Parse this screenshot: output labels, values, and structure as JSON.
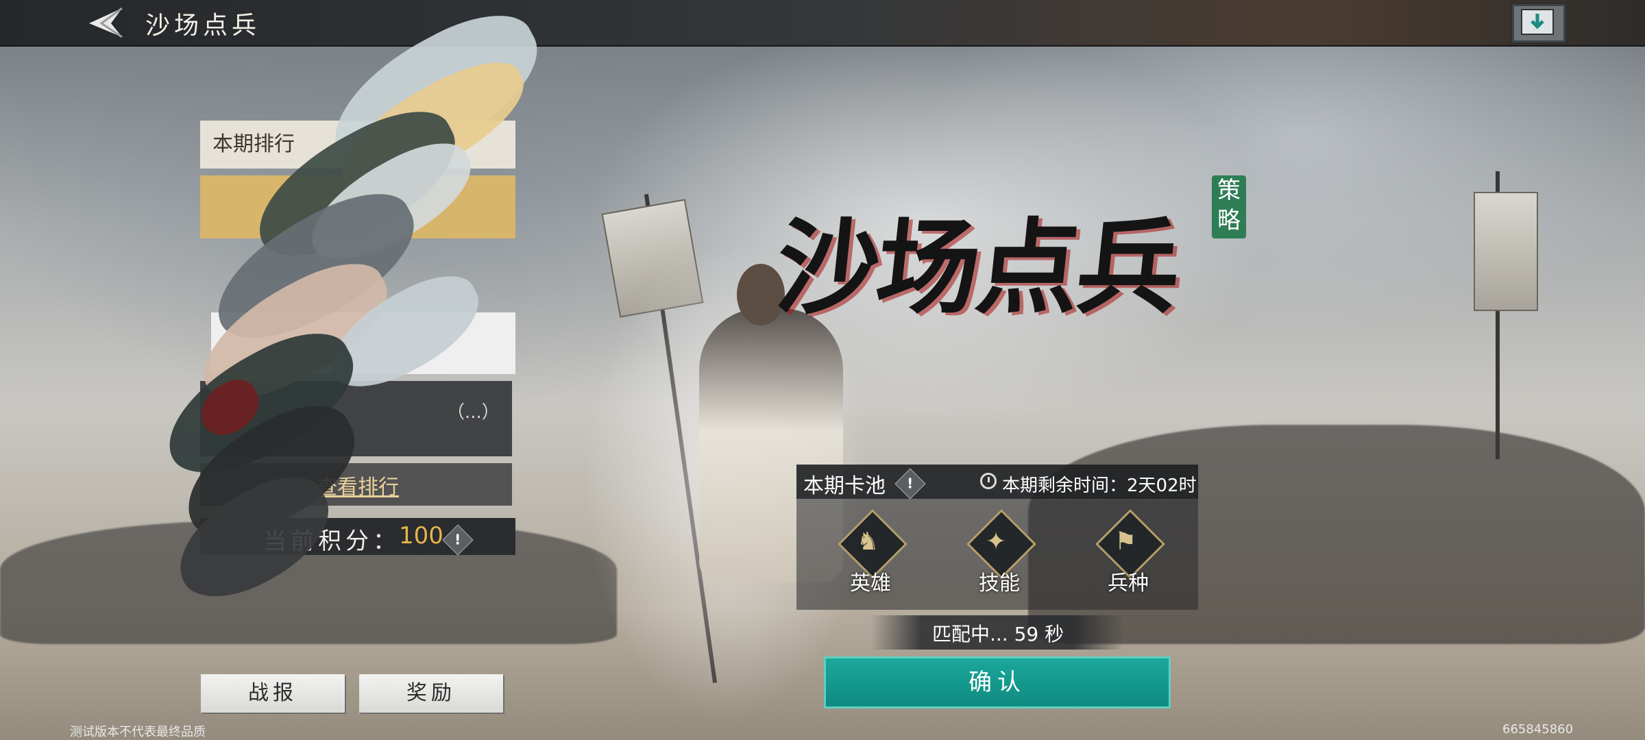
{
  "header": {
    "title": "沙场点兵"
  },
  "left_panel": {
    "header_label": "本期排行",
    "dark_row_text": "（...）",
    "view_ranking_label": "查看排行",
    "score_label": "当前积分：",
    "score_value": "100"
  },
  "logo": {
    "title": "沙场点兵",
    "seal": "策略"
  },
  "pool": {
    "title": "本期卡池",
    "remaining_time": "本期剩余时间：2天02时",
    "items": [
      {
        "label": "英雄",
        "icon": "hero-icon"
      },
      {
        "label": "技能",
        "icon": "skill-icon"
      },
      {
        "label": "兵种",
        "icon": "troop-icon"
      }
    ]
  },
  "matching": {
    "status": "匹配中... 59 秒"
  },
  "buttons": {
    "confirm": "确认",
    "battle_report": "战报",
    "rewards": "奖励"
  },
  "footer": {
    "disclaimer": "测试版本不代表最终品质",
    "id": "665845860"
  },
  "colors": {
    "accent": "#13998c",
    "score": "#e4b54c",
    "seal": "#2f7d55"
  }
}
